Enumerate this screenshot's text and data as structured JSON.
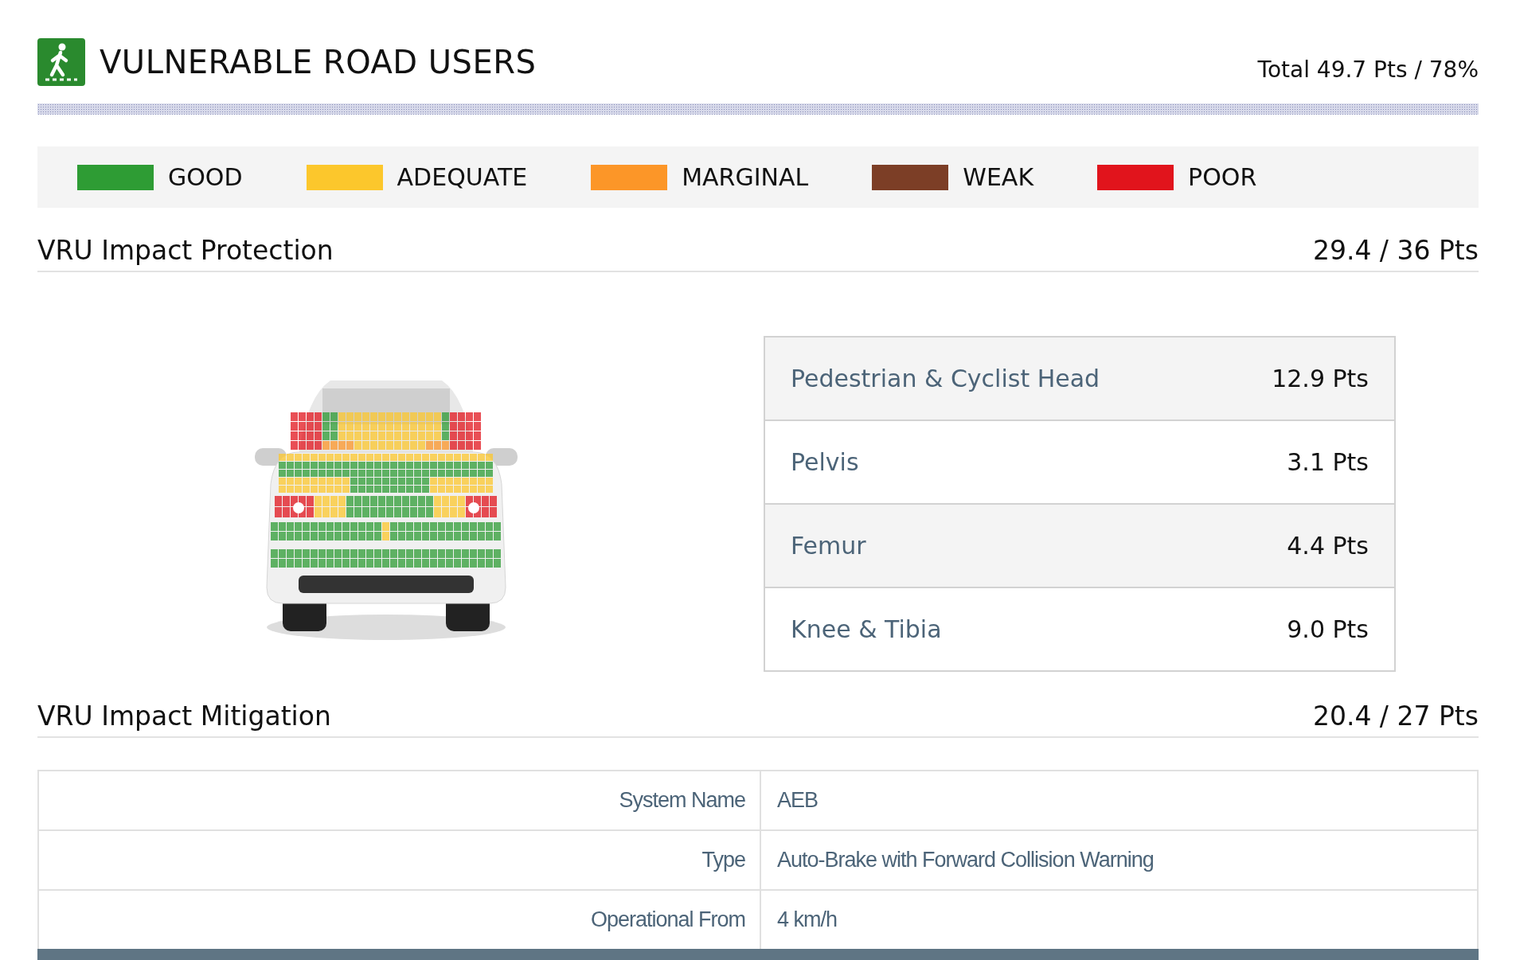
{
  "header": {
    "title": "VULNERABLE ROAD USERS",
    "total": "Total 49.7 Pts / 78%"
  },
  "legend": [
    {
      "label": "GOOD",
      "color": "#2e9c34"
    },
    {
      "label": "ADEQUATE",
      "color": "#fcc72c"
    },
    {
      "label": "MARGINAL",
      "color": "#fc9628"
    },
    {
      "label": "WEAK",
      "color": "#7c3e26"
    },
    {
      "label": "POOR",
      "color": "#e1141c"
    }
  ],
  "protection": {
    "title": "VRU Impact Protection",
    "score": "29.4 / 36 Pts",
    "rows": [
      {
        "label": "Pedestrian & Cyclist Head",
        "value": "12.9 Pts"
      },
      {
        "label": "Pelvis",
        "value": "3.1 Pts"
      },
      {
        "label": "Femur",
        "value": "4.4 Pts"
      },
      {
        "label": "Knee & Tibia",
        "value": "9.0 Pts"
      }
    ]
  },
  "mitigation": {
    "title": "VRU Impact Mitigation",
    "score": "20.4 / 27 Pts",
    "rows": [
      {
        "label": "System Name",
        "value": "AEB"
      },
      {
        "label": "Type",
        "value": "Auto-Brake with Forward Collision Warning"
      },
      {
        "label": "Operational From",
        "value": "4 km/h"
      }
    ]
  }
}
